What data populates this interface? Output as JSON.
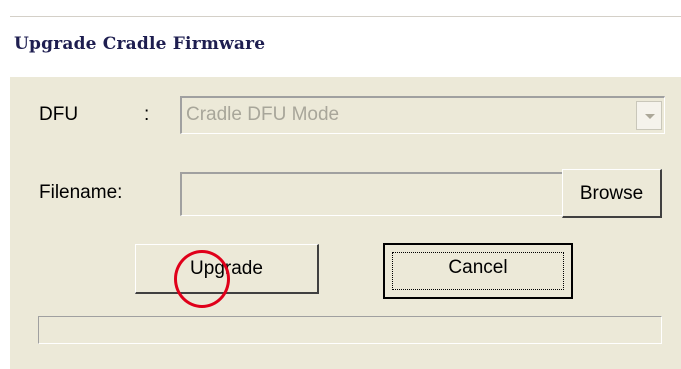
{
  "window": {
    "title": "Upgrade Cradle Firmware"
  },
  "form": {
    "dfu_label": "DFU",
    "dfu_separator": ":",
    "dfu_value": "Cradle DFU Mode",
    "filename_label": "Filename:",
    "filename_value": ""
  },
  "buttons": {
    "browse": "Browse",
    "upgrade": "Upgrade",
    "cancel": "Cancel"
  },
  "progress": {
    "value": 0
  },
  "annotation": {
    "color": "#e0001a"
  }
}
